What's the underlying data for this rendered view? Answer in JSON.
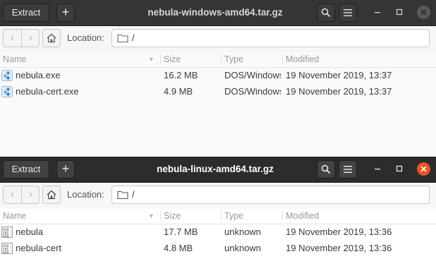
{
  "windows": [
    {
      "headerbar": {
        "extract_label": "Extract",
        "plus_label": "+",
        "title": "nebula-windows-amd64.tar.gz"
      },
      "location": {
        "label": "Location:",
        "value": "/"
      },
      "columns": {
        "name": "Name",
        "size": "Size",
        "type": "Type",
        "modified": "Modified"
      },
      "files": [
        {
          "name": "nebula.exe",
          "size": "16.2 MB",
          "type": "DOS/Windows executable",
          "modified": "19 November 2019, 13:37",
          "icon": "exe-icon"
        },
        {
          "name": "nebula-cert.exe",
          "size": "4.9 MB",
          "type": "DOS/Windows executable",
          "modified": "19 November 2019, 13:37",
          "icon": "exe-icon"
        }
      ],
      "close_color": "#5a5a5a"
    },
    {
      "headerbar": {
        "extract_label": "Extract",
        "plus_label": "+",
        "title": "nebula-linux-amd64.tar.gz"
      },
      "location": {
        "label": "Location:",
        "value": "/"
      },
      "columns": {
        "name": "Name",
        "size": "Size",
        "type": "Type",
        "modified": "Modified"
      },
      "files": [
        {
          "name": "nebula",
          "size": "17.7 MB",
          "type": "unknown",
          "modified": "19 November 2019, 13:36",
          "icon": "binary-file-icon"
        },
        {
          "name": "nebula-cert",
          "size": "4.8 MB",
          "type": "unknown",
          "modified": "19 November 2019, 13:36",
          "icon": "binary-file-icon"
        }
      ],
      "close_color": "#e95420"
    }
  ]
}
